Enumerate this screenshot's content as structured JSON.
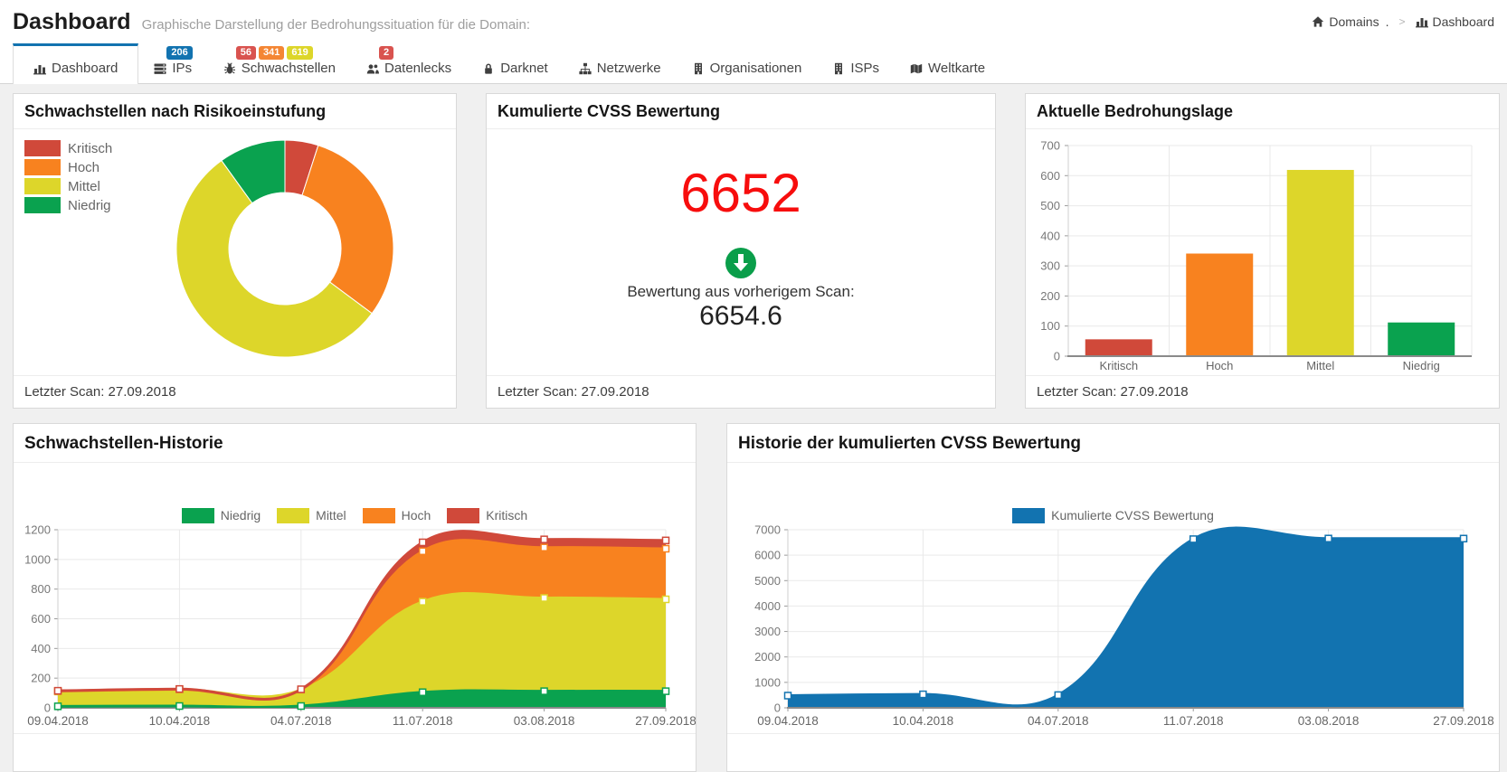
{
  "header": {
    "title": "Dashboard",
    "subtitle": "Graphische Darstellung der Bedrohungssituation für die Domain:",
    "breadcrumb": {
      "root": "Domains",
      "domain": ".",
      "separator": ">",
      "current": "Dashboard"
    }
  },
  "tabs": [
    {
      "id": "dashboard",
      "label": "Dashboard",
      "icon": "bar-chart",
      "active": true,
      "badges": []
    },
    {
      "id": "ips",
      "label": "IPs",
      "icon": "server",
      "active": false,
      "badges": [
        {
          "text": "206",
          "color": "#1273b0"
        }
      ]
    },
    {
      "id": "schwachstellen",
      "label": "Schwachstellen",
      "icon": "bug",
      "active": false,
      "badges": [
        {
          "text": "56",
          "color": "#d9534f"
        },
        {
          "text": "341",
          "color": "#f48634"
        },
        {
          "text": "619",
          "color": "#ddd62a"
        }
      ]
    },
    {
      "id": "datenlecks",
      "label": "Datenlecks",
      "icon": "users",
      "active": false,
      "badges": [
        {
          "text": "2",
          "color": "#d9534f"
        }
      ]
    },
    {
      "id": "darknet",
      "label": "Darknet",
      "icon": "lock",
      "active": false,
      "badges": []
    },
    {
      "id": "netzwerke",
      "label": "Netzwerke",
      "icon": "sitemap",
      "active": false,
      "badges": []
    },
    {
      "id": "organisationen",
      "label": "Organisationen",
      "icon": "building",
      "active": false,
      "badges": []
    },
    {
      "id": "isps",
      "label": "ISPs",
      "icon": "building",
      "active": false,
      "badges": []
    },
    {
      "id": "weltkarte",
      "label": "Weltkarte",
      "icon": "map",
      "active": false,
      "badges": []
    }
  ],
  "chart_data": [
    {
      "id": "risk_donut",
      "type": "pie",
      "donut": true,
      "title": "Schwachstellen nach Risikoeinstufung",
      "labels": [
        "Kritisch",
        "Hoch",
        "Mittel",
        "Niedrig"
      ],
      "values": [
        56,
        341,
        619,
        112
      ],
      "colors": [
        "#d0493a",
        "#f8821f",
        "#ddd62a",
        "#0aa24f"
      ],
      "legend_position": "left",
      "footer": "Letzter Scan: 27.09.2018"
    },
    {
      "id": "cvss_current",
      "type": "number",
      "title": "Kumulierte CVSS Bewertung",
      "value": "6652",
      "value_color": "#f70d0d",
      "trend_icon": "arrow-circle-down",
      "trend_color": "#0a9e4a",
      "prev_label": "Bewertung aus vorherigem Scan:",
      "prev_value": "6654.6",
      "footer": "Letzter Scan: 27.09.2018"
    },
    {
      "id": "threat_bars",
      "type": "bar",
      "title": "Aktuelle Bedrohungslage",
      "categories": [
        "Kritisch",
        "Hoch",
        "Mittel",
        "Niedrig"
      ],
      "values": [
        56,
        341,
        619,
        112
      ],
      "colors": [
        "#d0493a",
        "#f8821f",
        "#ddd62a",
        "#0aa24f"
      ],
      "ylim": [
        0,
        700
      ],
      "ystep": 100,
      "grid": true,
      "footer": "Letzter Scan: 27.09.2018"
    },
    {
      "id": "vuln_history",
      "type": "area",
      "stacked": true,
      "title": "Schwachstellen-Historie",
      "x": [
        "09.04.2018",
        "10.04.2018",
        "04.07.2018",
        "11.07.2018",
        "03.08.2018",
        "27.09.2018"
      ],
      "series": [
        {
          "name": "Niedrig",
          "color": "#0aa24f",
          "values": [
            10,
            12,
            12,
            105,
            112,
            112
          ]
        },
        {
          "name": "Mittel",
          "color": "#ddd62a",
          "values": [
            100,
            110,
            108,
            610,
            628,
            619
          ]
        },
        {
          "name": "Hoch",
          "color": "#f8821f",
          "values": [
            3,
            3,
            3,
            340,
            340,
            341
          ]
        },
        {
          "name": "Kritisch",
          "color": "#d0493a",
          "values": [
            2,
            2,
            2,
            60,
            55,
            56
          ]
        }
      ],
      "ylim": [
        0,
        1200
      ],
      "ystep": 200,
      "grid": true,
      "legend_position": "top"
    },
    {
      "id": "cvss_history",
      "type": "area",
      "stacked": false,
      "title": "Historie der kumulierten CVSS Bewertung",
      "x": [
        "09.04.2018",
        "10.04.2018",
        "04.07.2018",
        "11.07.2018",
        "03.08.2018",
        "27.09.2018"
      ],
      "series": [
        {
          "name": "Kumulierte CVSS Bewertung",
          "color": "#1273b0",
          "values": [
            480,
            530,
            500,
            6630,
            6654.6,
            6652
          ]
        }
      ],
      "ylim": [
        0,
        7000
      ],
      "ystep": 1000,
      "grid": true,
      "legend_position": "top"
    }
  ]
}
